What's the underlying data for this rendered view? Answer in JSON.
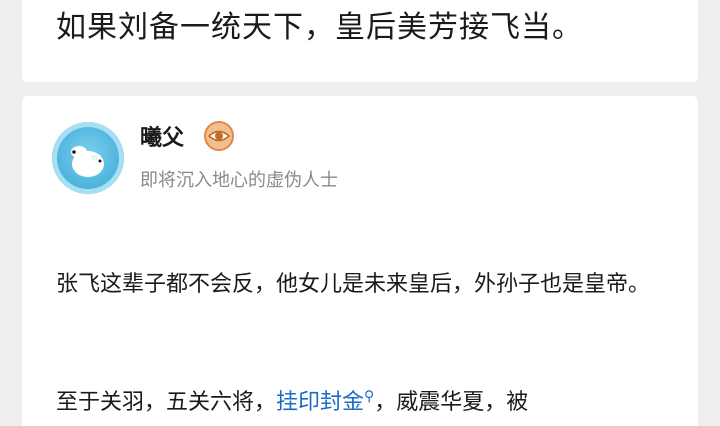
{
  "previous_answer": {
    "text_fragment": "如果刘备一统天下，皇后美芳接飞当。"
  },
  "answer": {
    "author": {
      "name": "曦父",
      "badge_icon": "eye-badge-icon",
      "bio": "即将沉入地心的虚伪人士"
    },
    "paragraph_1": "张飞这辈子都不会反，他女儿是未来皇后，外孙子也是皇帝。",
    "paragraph_2": {
      "prefix": "至于关羽，五关六将，",
      "link_text": "挂印封金",
      "link_icon": "search-icon",
      "suffix": "，威震华夏，被"
    }
  }
}
